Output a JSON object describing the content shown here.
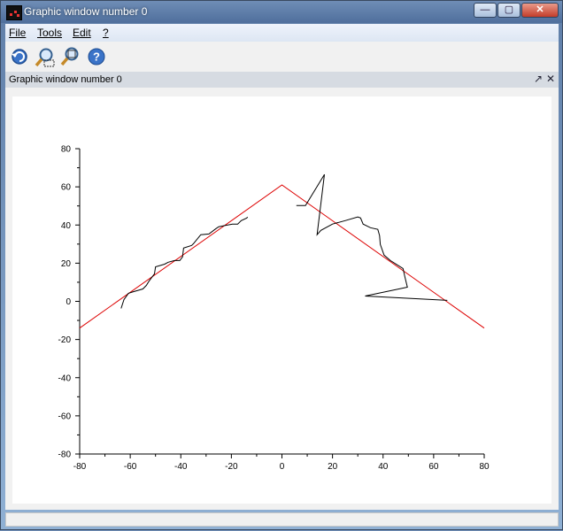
{
  "window": {
    "title": "Graphic window number 0",
    "minimize_glyph": "—",
    "maximize_glyph": "▢",
    "close_glyph": "✕"
  },
  "menu": {
    "file_label": "File",
    "tools_label": "Tools",
    "edit_label": "Edit",
    "help_label": "?"
  },
  "toolbar": {
    "buttons": [
      "rotate-icon",
      "zoom-icon",
      "unzoom-icon",
      "help-icon"
    ]
  },
  "panel": {
    "title": "Graphic window number 0",
    "undock_glyph": "↗",
    "close_glyph": "✕"
  },
  "chart_data": {
    "type": "line",
    "xlim": [
      -80,
      80
    ],
    "ylim": [
      -80,
      80
    ],
    "x_ticks": [
      "-80",
      "-60",
      "-40",
      "-20",
      "0",
      "20",
      "40",
      "60",
      "80"
    ],
    "y_ticks": [
      "80",
      "60",
      "40",
      "20",
      "0",
      "-20",
      "-40",
      "-60",
      "-80"
    ],
    "grid": false,
    "colors": {
      "red_line": "#dd0000",
      "black_line": "#000000"
    },
    "series": [
      {
        "color": "#dd0000",
        "x": [
          -80,
          0,
          80
        ],
        "y": [
          -14,
          61,
          -14
        ]
      },
      {
        "color": "#000000",
        "x": [
          -63.6,
          -62.5,
          -60.7,
          -58.6,
          -55,
          -53.6,
          -52.5,
          -50.4,
          -50,
          -46.4,
          -45,
          -42.5,
          -40.4,
          -39.3,
          -38.9,
          -35.7,
          -35,
          -32.1,
          -28.9,
          -26.1,
          -25,
          -19.6,
          -17.5,
          -16.1,
          -13.9,
          -13.6
        ],
        "y": [
          -3.7,
          0.9,
          4.2,
          5.1,
          6.5,
          8.4,
          10.7,
          14.4,
          18.1,
          19.5,
          20.5,
          21.4,
          21.4,
          23.3,
          27.9,
          29.3,
          30.2,
          34.9,
          35.3,
          38.1,
          39.1,
          40.5,
          40.5,
          42.3,
          43.7,
          44.2
        ]
      },
      {
        "color": "#000000",
        "x": [
          5.7,
          9.3,
          16.8,
          13.9,
          15.4,
          20,
          25,
          30,
          31.1,
          32.1,
          35,
          37.9,
          38.6,
          38.9,
          40.4,
          42.9,
          47.9,
          48.6,
          49.6,
          32.9,
          65.4
        ],
        "y": [
          50.2,
          50.2,
          66.5,
          34.9,
          37.2,
          40.5,
          42.3,
          44.2,
          43.7,
          40.5,
          38.6,
          37.7,
          34.4,
          29.8,
          24.2,
          21.4,
          17.2,
          13.0,
          7.4,
          2.8,
          0.5
        ]
      }
    ]
  }
}
